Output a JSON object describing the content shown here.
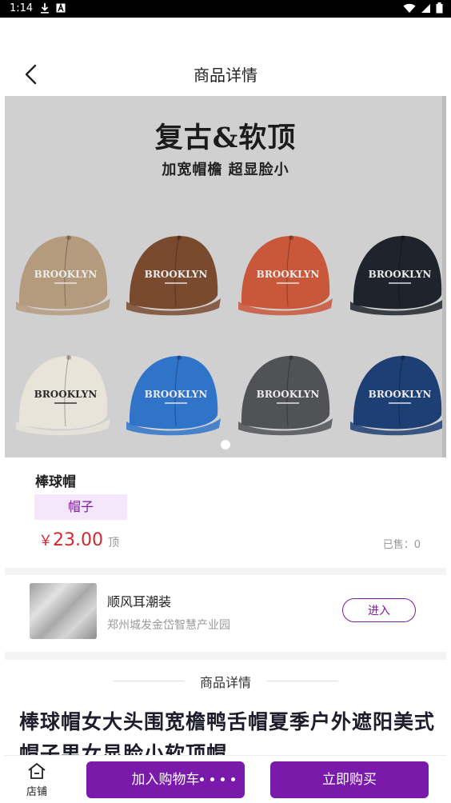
{
  "status_bar": {
    "time": "1:14"
  },
  "header": {
    "title": "商品详情"
  },
  "banner": {
    "title": "复古&软顶",
    "subtitle": "加宽帽檐  超显脸小",
    "cap_colors": [
      "#b59b7e",
      "#7a4a2f",
      "#c9573a",
      "#1f242c",
      "#e8e4da",
      "#2f74c9",
      "#505256",
      "#1d3f73"
    ],
    "cap_brand": "BROOKLYN"
  },
  "product": {
    "name": "棒球帽",
    "tag": "帽子",
    "currency": "￥",
    "price": "23.00",
    "unit": "顶",
    "sold": "已售：0"
  },
  "shop": {
    "name": "顺风耳潮装",
    "address": "郑州城发金岱智慧产业园",
    "enter_label": "进入"
  },
  "details": {
    "heading": "商品详情",
    "description": "棒球帽女大头围宽檐鸭舌帽夏季户外遮阳美式帽子男女显脸小软顶帽"
  },
  "bottom_bar": {
    "shop_label": "店铺",
    "add_cart_label": "加入购物车",
    "buy_now_label": "立即购买"
  },
  "colors": {
    "accent": "#7a1aaa",
    "price": "#d4272f",
    "tag_bg": "#f4e6fb"
  }
}
